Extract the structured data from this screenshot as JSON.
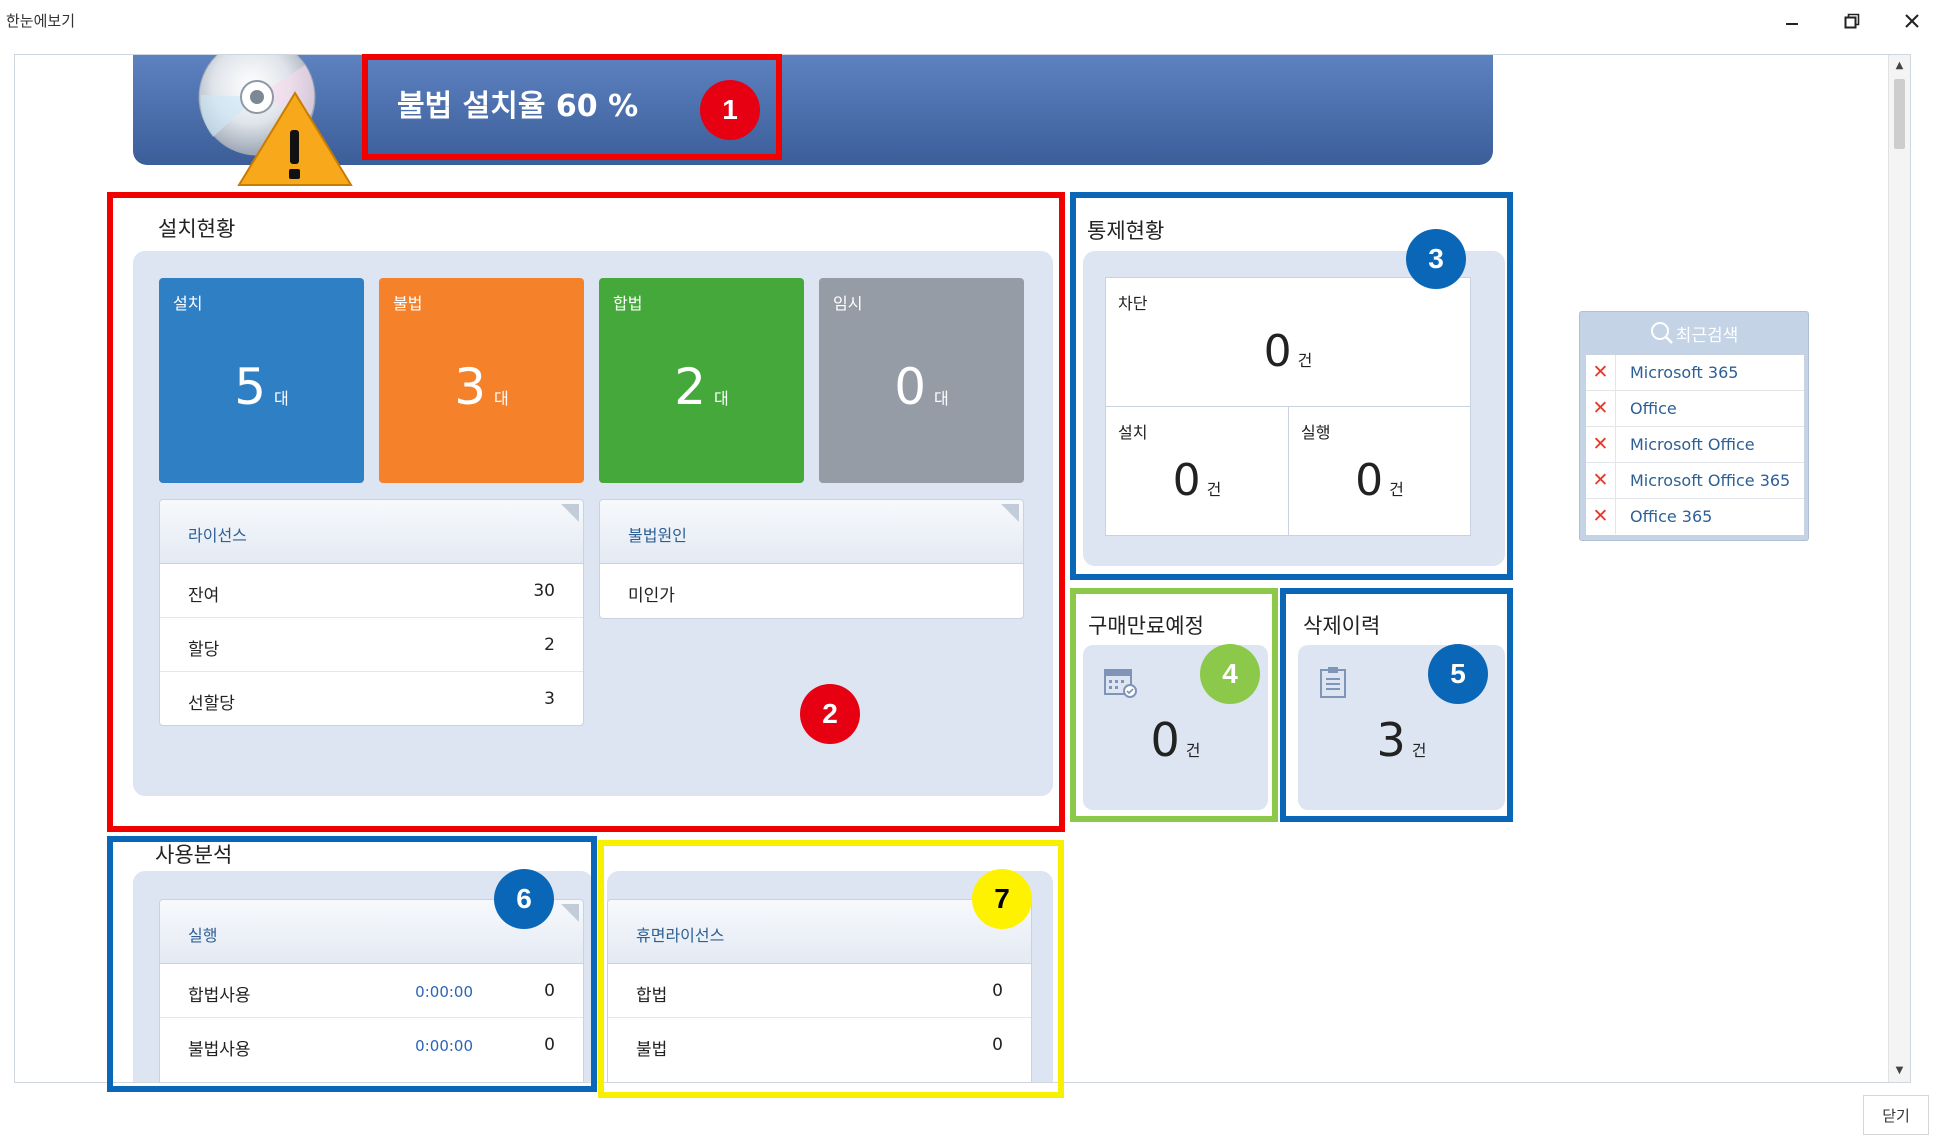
{
  "window": {
    "title": "한눈에보기",
    "minimize_icon": "minimize-icon",
    "restore_icon": "restore-icon",
    "close_icon": "close-icon"
  },
  "banner": {
    "title": "불법 설치율 60 %",
    "icon": "cd-warning-icon",
    "color_top": "#5d82c0",
    "color_bottom": "#3b5e99"
  },
  "annotations": [
    "1",
    "2",
    "3",
    "4",
    "5",
    "6",
    "7"
  ],
  "install_status": {
    "title": "설치현황",
    "tiles": [
      {
        "label": "설치",
        "value": "5",
        "unit": "대",
        "color": "#2f7fc4"
      },
      {
        "label": "불법",
        "value": "3",
        "unit": "대",
        "color": "#f5822a"
      },
      {
        "label": "합법",
        "value": "2",
        "unit": "대",
        "color": "#44a93a"
      },
      {
        "label": "임시",
        "value": "0",
        "unit": "대",
        "color": "#959ca6"
      }
    ],
    "license": {
      "title": "라이선스",
      "rows": [
        {
          "label": "잔여",
          "value": "30"
        },
        {
          "label": "할당",
          "value": "2"
        },
        {
          "label": "선할당",
          "value": "3"
        }
      ]
    },
    "illegal_cause": {
      "title": "불법원인",
      "rows": [
        {
          "label": "미인가"
        }
      ]
    }
  },
  "control_status": {
    "title": "통제현황",
    "block": {
      "label": "차단",
      "value": "0",
      "unit": "건"
    },
    "install": {
      "label": "설치",
      "value": "0",
      "unit": "건"
    },
    "run": {
      "label": "실행",
      "value": "0",
      "unit": "건"
    }
  },
  "purchase_expiry": {
    "title": "구매만료예정",
    "value": "0",
    "unit": "건",
    "icon": "calendar-icon"
  },
  "delete_history": {
    "title": "삭제이력",
    "value": "3",
    "unit": "건",
    "icon": "clipboard-icon"
  },
  "usage_analysis": {
    "title": "사용분석",
    "card_title": "실행",
    "rows": [
      {
        "label": "합법사용",
        "time": "0:00:00",
        "value": "0"
      },
      {
        "label": "불법사용",
        "time": "0:00:00",
        "value": "0"
      }
    ]
  },
  "dormant": {
    "card_title": "휴면라이선스",
    "rows": [
      {
        "label": "합법",
        "value": "0"
      },
      {
        "label": "불법",
        "value": "0"
      }
    ]
  },
  "recent_search": {
    "title": "최근검색",
    "items": [
      "Microsoft 365",
      "Office",
      "Microsoft Office",
      "Microsoft Office 365",
      "Office 365"
    ]
  },
  "footer": {
    "close_label": "닫기"
  }
}
